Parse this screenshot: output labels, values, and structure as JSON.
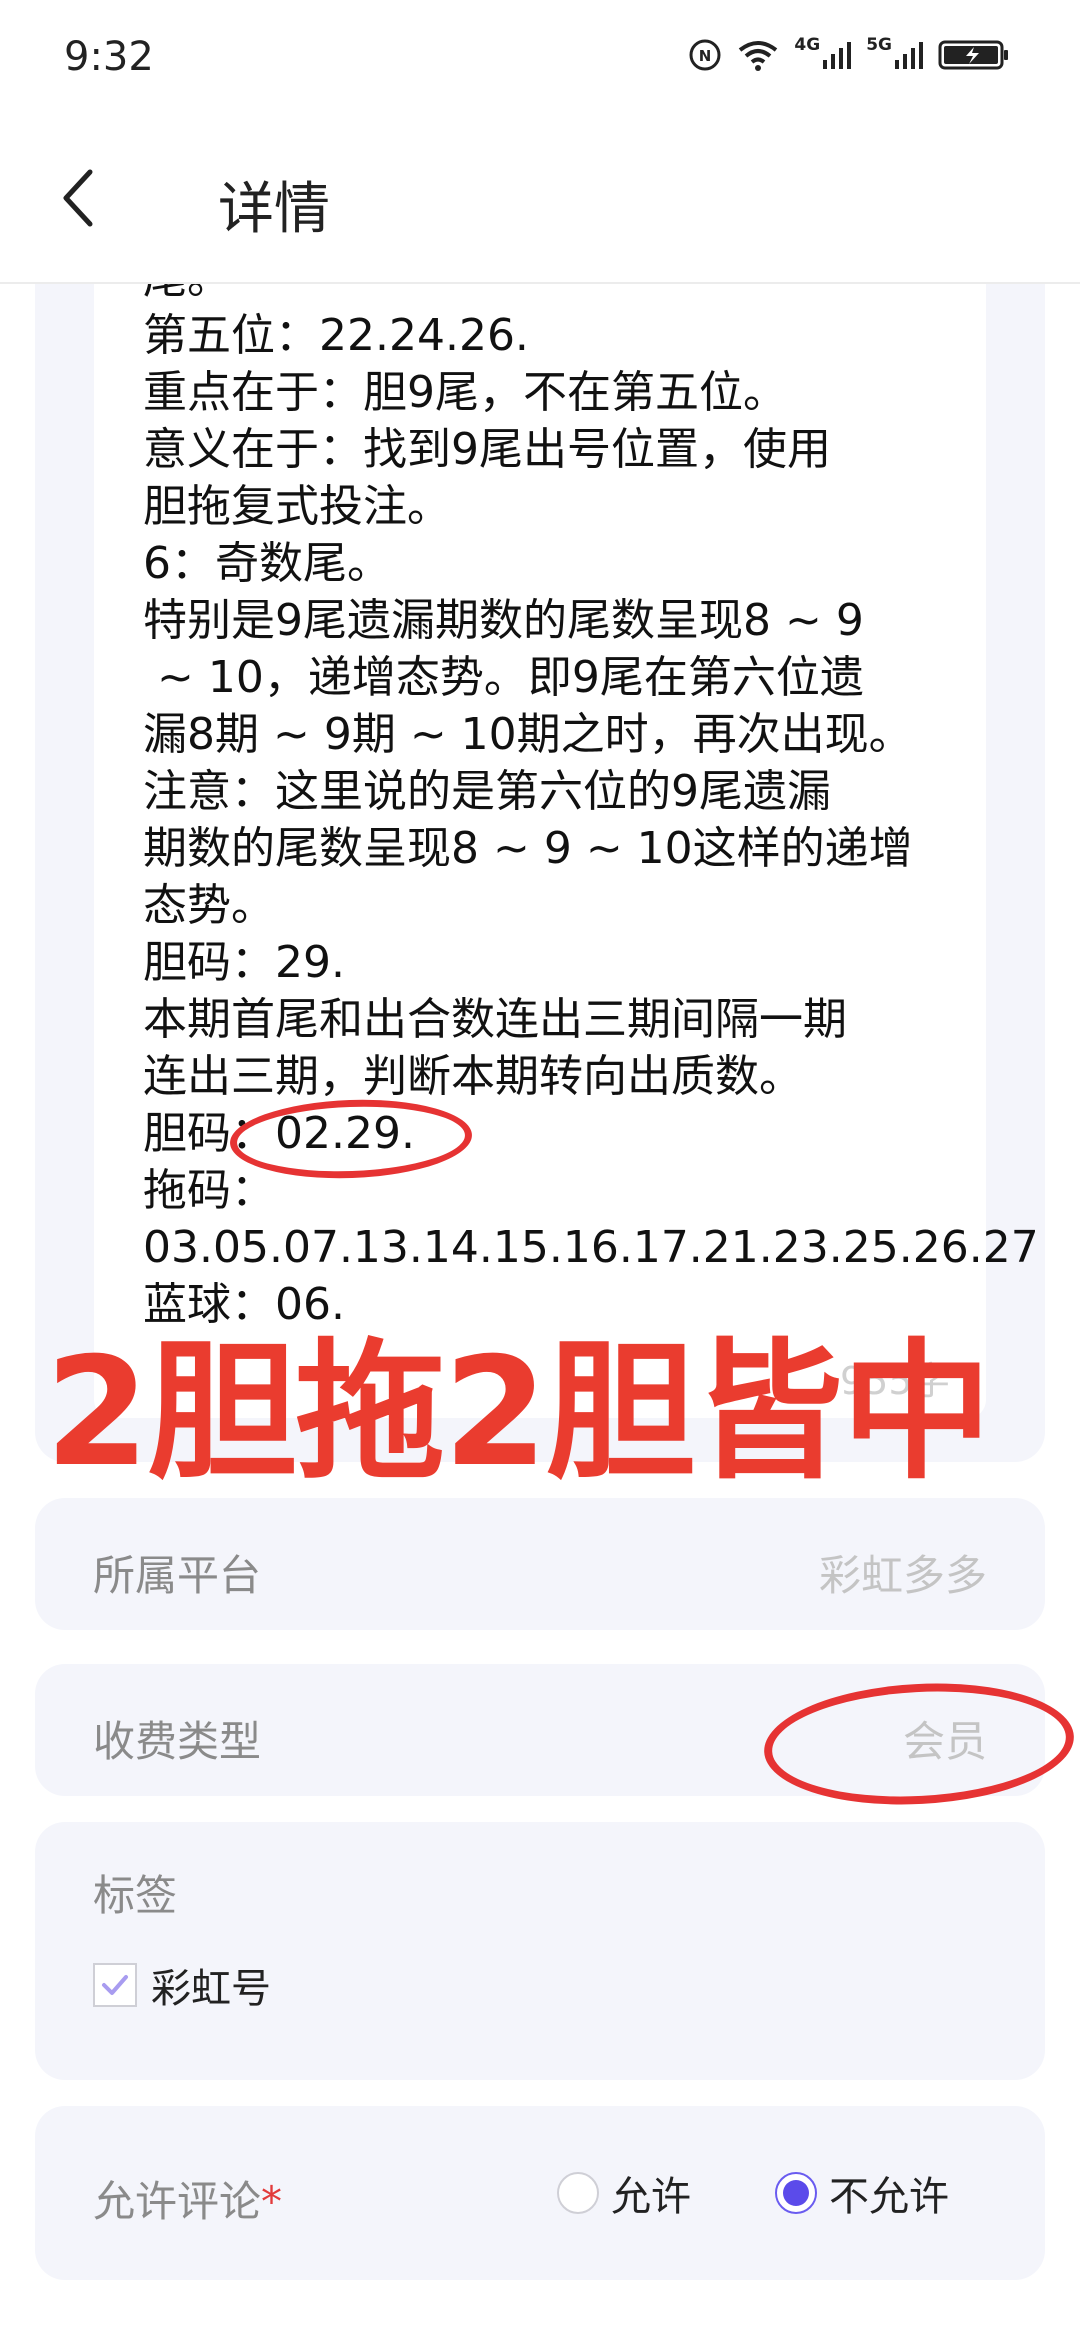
{
  "status_bar": {
    "time": "9:32",
    "signal_4g": "4G",
    "signal_5g": "5G",
    "icons": [
      "nfc-icon",
      "wifi-icon",
      "signal-4g-icon",
      "signal-5g-icon",
      "battery-charging-icon"
    ]
  },
  "header": {
    "title": "详情",
    "back_icon": "chevron-left-icon"
  },
  "content": {
    "lines": "尾。\n第五位：22.24.26.\n重点在于：胆9尾，不在第五位。\n意义在于：找到9尾出号位置，使用\n胆拖复式投注。\n6：奇数尾。\n特别是9尾遗漏期数的尾数呈现8 ~ 9\n ~ 10，递增态势。即9尾在第六位遗\n漏8期 ~ 9期 ~ 10期之时，再次出现。\n注意：这里说的是第六位的9尾遗漏\n期数的尾数呈现8 ~ 9 ~ 10这样的递增\n态势。\n胆码：29.\n本期首尾和出合数连出三期间隔一期\n连出三期，判断本期转向出质数。\n胆码：02.29.\n拖码：\n03.05.07.13.14.15.16.17.21.23.25.26.27\n蓝球：06.",
    "char_count": "955字"
  },
  "overlay": {
    "text": "2胆拖2胆皆中",
    "color": "#ea3c2f"
  },
  "form": {
    "platform": {
      "label": "所属平台",
      "value": "彩虹多多"
    },
    "fee_type": {
      "label": "收费类型",
      "value": "会员"
    },
    "tags": {
      "label": "标签",
      "option": "彩虹号",
      "checked": true
    },
    "comment": {
      "label": "允许评论",
      "required_mark": "*",
      "options": [
        "允许",
        "不允许"
      ],
      "selected": "不允许"
    }
  },
  "colors": {
    "accent": "#5b4bea",
    "annotation_red": "#e63333",
    "row_background": "#f4f5fb"
  }
}
